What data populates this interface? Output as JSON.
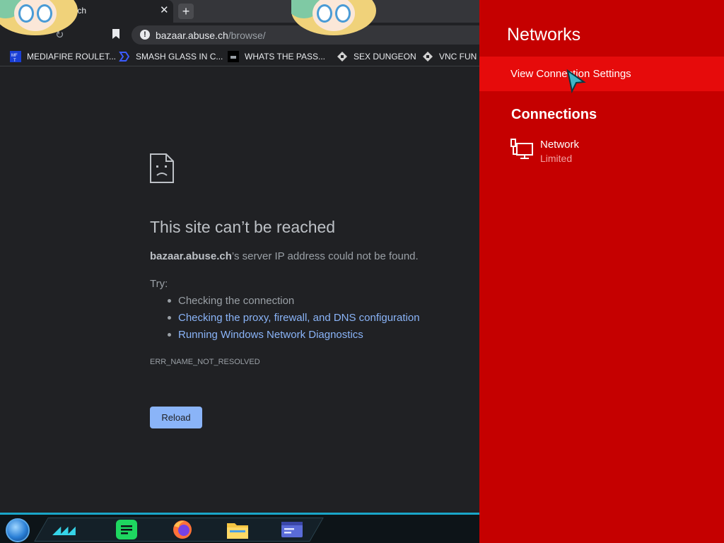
{
  "browser": {
    "tab": {
      "title": ".ch",
      "close_glyph": "✕"
    },
    "new_tab_glyph": "+",
    "omnibox": {
      "host": "bazaar.abuse.ch",
      "path": "/browse/"
    },
    "bookmarks": [
      {
        "label": "MEDIAFIRE ROULET...",
        "icon": "mediafire-icon"
      },
      {
        "label": "SMASH GLASS IN C...",
        "icon": "bookmark-app-icon"
      },
      {
        "label": "WHATS THE PASS...",
        "icon": "bookmark-app-icon"
      },
      {
        "label": "SEX DUNGEON",
        "icon": "bookmark-app-icon"
      },
      {
        "label": "VNC FUN",
        "icon": "bookmark-app-icon"
      }
    ],
    "error": {
      "title": "This site can’t be reached",
      "host_bold": "bazaar.abuse.ch",
      "desc_rest": "’s server IP address could not be found.",
      "try_label": "Try:",
      "suggestions": [
        "Checking the connection",
        "Checking the proxy, firewall, and DNS configuration",
        "Running Windows Network Diagnostics"
      ],
      "code": "ERR_NAME_NOT_RESOLVED",
      "reload_label": "Reload"
    }
  },
  "panel": {
    "title": "Networks",
    "view_settings_label": "View Connection Settings",
    "connections_title": "Connections",
    "network": {
      "name": "Network",
      "status": "Limited"
    }
  },
  "colors": {
    "panel_bg": "#c50000",
    "panel_highlight": "#e60b0b",
    "link": "#8ab4f8"
  }
}
